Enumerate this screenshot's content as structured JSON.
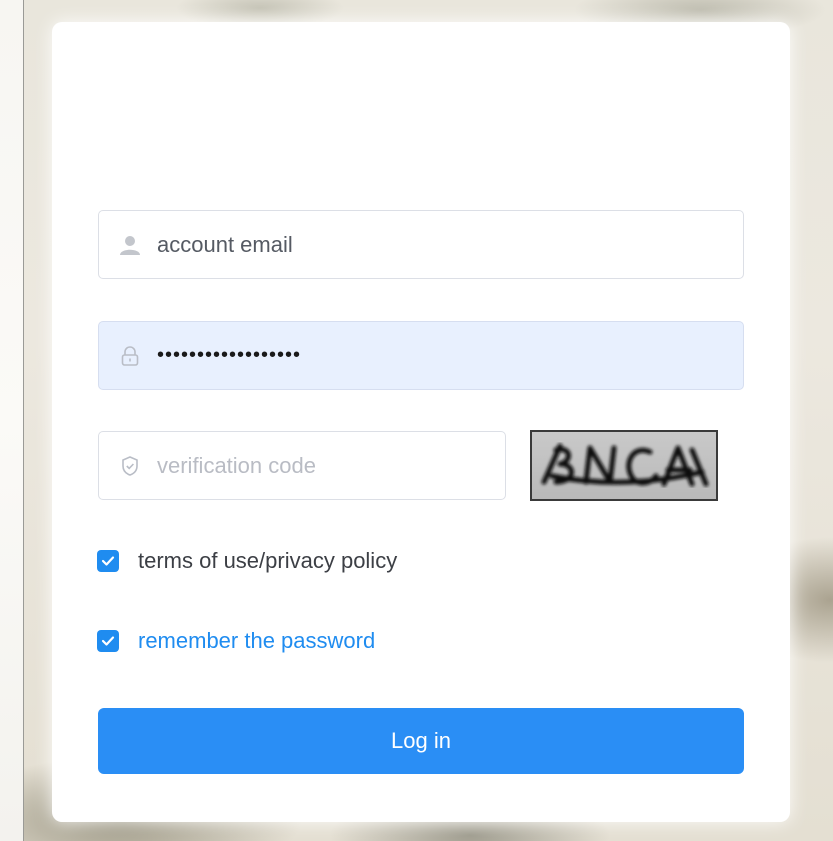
{
  "form": {
    "email": {
      "placeholder": "account email",
      "icon": "user-icon"
    },
    "password": {
      "value": "••••••••••••••••••",
      "icon": "lock-icon"
    },
    "verification": {
      "placeholder": "verification code",
      "icon": "shield-icon"
    },
    "captcha": {
      "text": "BNCA"
    },
    "terms": {
      "label": "terms of use/privacy policy",
      "checked": true
    },
    "remember": {
      "label": "remember the password",
      "checked": true
    },
    "submit_label": "Log in"
  },
  "colors": {
    "accent": "#1f8cf0",
    "button": "#2a8ef5",
    "password_fill": "#e8f0fe",
    "border": "#dcdfe6"
  }
}
